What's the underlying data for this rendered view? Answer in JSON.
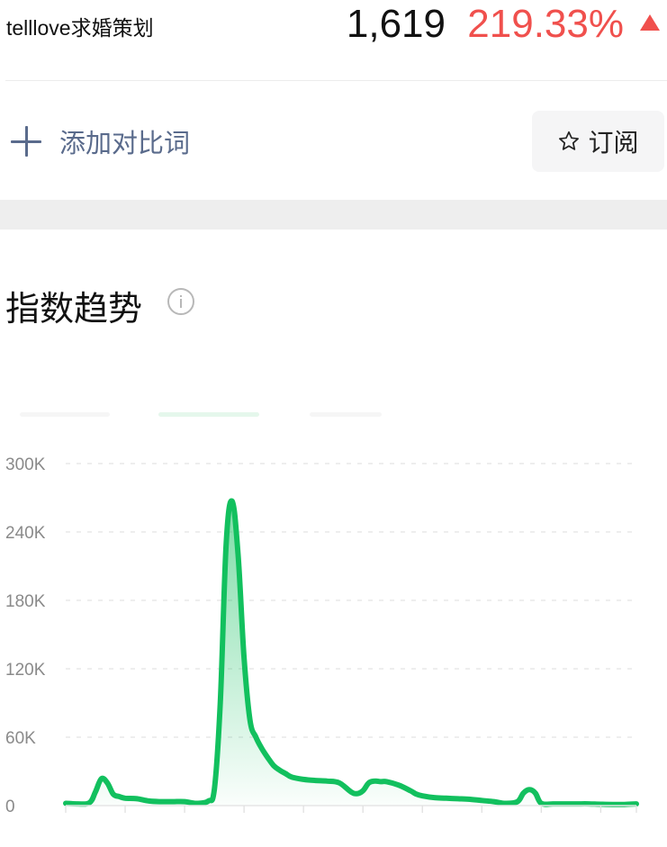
{
  "header": {
    "keyword": "telllove求婚策划",
    "count": "1,619",
    "change": "219.33%",
    "accent_up": "#f0504d"
  },
  "actions": {
    "add_compare_label": "添加对比词",
    "subscribe_label": "订阅",
    "add_icon": "plus-icon",
    "subscribe_icon": "star-icon"
  },
  "section": {
    "title": "指数趋势",
    "info_icon": "info-icon"
  },
  "chart_data": {
    "type": "area",
    "title": "",
    "xlabel": "",
    "ylabel": "",
    "ylim": [
      0,
      300000
    ],
    "y_ticks": [
      "0",
      "60K",
      "120K",
      "180K",
      "240K",
      "300K"
    ],
    "y_tick_values": [
      0,
      60000,
      120000,
      180000,
      240000,
      300000
    ],
    "grid": true,
    "legend": "none",
    "line_color": "#12c05e",
    "x_range": [
      0,
      96
    ],
    "x_tick_positions": [
      0,
      10,
      20,
      30,
      40,
      50,
      60,
      70,
      80,
      90,
      96
    ],
    "series": [
      {
        "x": [
          0,
          2,
          4,
          5,
          6,
          7,
          8,
          9,
          10,
          12,
          14,
          16,
          18,
          20,
          22,
          24,
          25,
          26,
          27,
          28,
          29,
          30,
          31,
          32,
          33,
          34,
          35,
          36,
          37,
          38,
          40,
          42,
          44,
          46,
          48,
          49,
          50,
          51,
          52,
          53,
          54,
          56,
          58,
          59,
          60,
          62,
          64,
          66,
          68,
          70,
          72,
          74,
          76,
          77,
          78,
          79,
          80,
          82,
          84,
          86,
          88,
          90,
          92,
          94,
          96
        ],
        "values": [
          2000,
          1500,
          2500,
          12000,
          23500,
          20000,
          10000,
          8000,
          6500,
          6000,
          4000,
          3500,
          3500,
          3500,
          2000,
          4000,
          14000,
          90000,
          230000,
          267000,
          220000,
          130000,
          75000,
          60000,
          50000,
          42000,
          35000,
          31000,
          28000,
          25000,
          23000,
          22000,
          21500,
          20000,
          12000,
          10500,
          13000,
          20000,
          21500,
          21000,
          21000,
          18000,
          13000,
          10000,
          8500,
          7000,
          6500,
          6000,
          5500,
          4500,
          3500,
          2000,
          3500,
          11000,
          14000,
          11000,
          2000,
          1500,
          1500,
          1500,
          1500,
          1200,
          1000,
          1000,
          1500
        ]
      }
    ]
  }
}
